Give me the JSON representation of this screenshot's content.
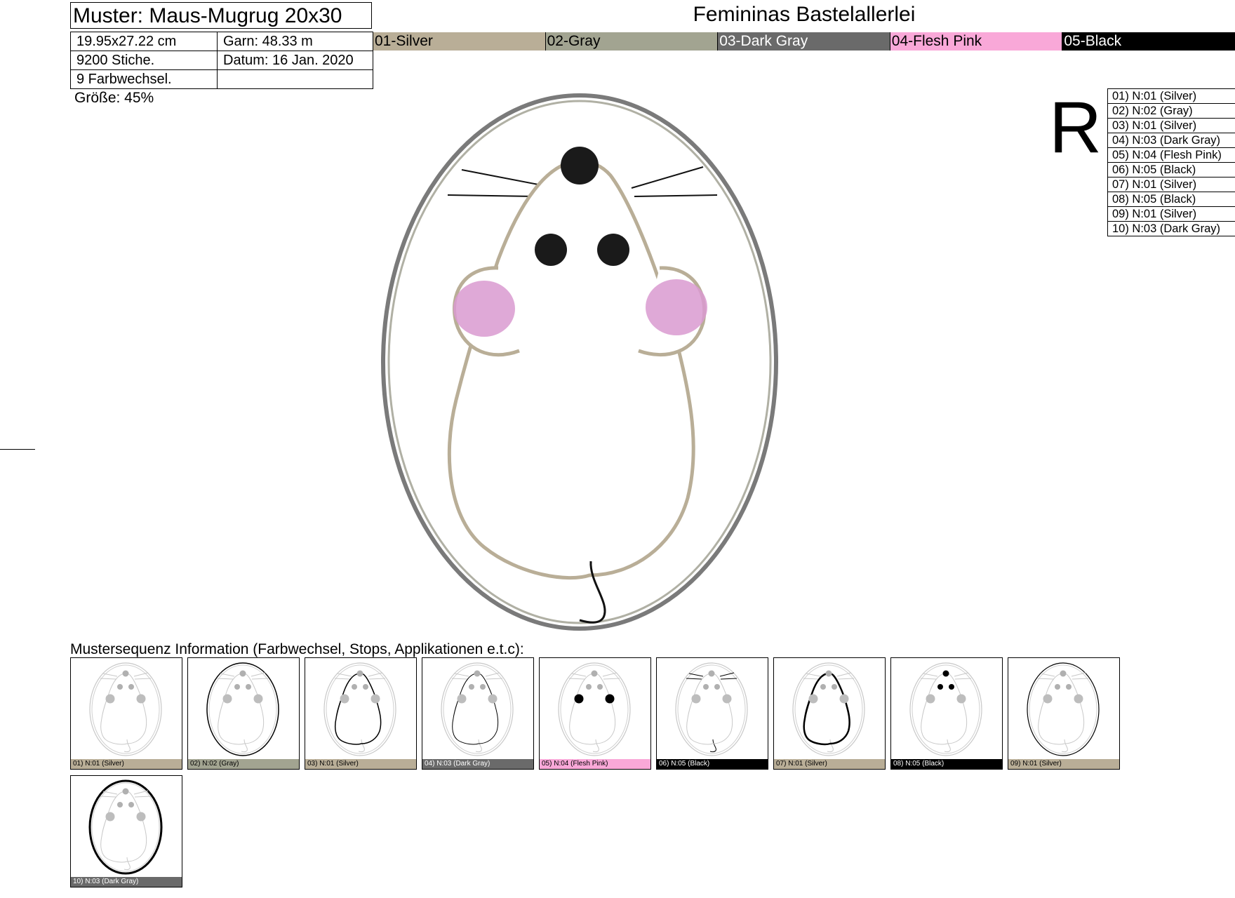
{
  "header": {
    "title": "Muster: Maus-Mugrug 20x30",
    "dimensions": "19.95x27.22 cm",
    "yarn": "Garn: 48.33 m",
    "stitches": "9200 Stiche.",
    "date": "Datum: 16 Jan. 2020",
    "color_changes": "9 Farbwechsel.",
    "size": "Größe: 45%"
  },
  "company": "Femininas Bastelallerlei",
  "rotation_marker": "R",
  "palette": [
    {
      "label": "01-Silver",
      "color": "#b9ae97",
      "text": "#000000"
    },
    {
      "label": "02-Gray",
      "color": "#a2a491",
      "text": "#000000"
    },
    {
      "label": "03-Dark Gray",
      "color": "#6a6a6a",
      "text": "#ffffff"
    },
    {
      "label": "04-Flesh Pink",
      "color": "#f9a8d8",
      "text": "#000000"
    },
    {
      "label": "05-Black",
      "color": "#000000",
      "text": "#ffffff"
    }
  ],
  "sequence": [
    "01) N:01 (Silver)",
    "02) N:02 (Gray)",
    "03) N:01 (Silver)",
    "04) N:03 (Dark Gray)",
    "05) N:04 (Flesh Pink)",
    "06) N:05 (Black)",
    "07) N:01 (Silver)",
    "08) N:05 (Black)",
    "09) N:01 (Silver)",
    "10) N:03 (Dark Gray)"
  ],
  "thumbnails": {
    "label": "Mustersequenz Information (Farbwechsel, Stops, Applikationen e.t.c):",
    "items": [
      {
        "caption": "01) N:01 (Silver)",
        "color": "#b9ae97",
        "text": "#000000",
        "highlight": "none"
      },
      {
        "caption": "02) N:02 (Gray)",
        "color": "#a2a491",
        "text": "#000000",
        "highlight": "oval-inner"
      },
      {
        "caption": "03) N:01 (Silver)",
        "color": "#b9ae97",
        "text": "#000000",
        "highlight": "body"
      },
      {
        "caption": "04) N:03 (Dark Gray)",
        "color": "#6a6a6a",
        "text": "#ffffff",
        "highlight": "body-thin"
      },
      {
        "caption": "05) N:04 (Flesh Pink)",
        "color": "#f9a8d8",
        "text": "#000000",
        "highlight": "cheeks"
      },
      {
        "caption": "06) N:05 (Black)",
        "color": "#000000",
        "text": "#ffffff",
        "highlight": "whiskers-tail"
      },
      {
        "caption": "07) N:01 (Silver)",
        "color": "#b9ae97",
        "text": "#000000",
        "highlight": "body-bold"
      },
      {
        "caption": "08) N:05 (Black)",
        "color": "#000000",
        "text": "#ffffff",
        "highlight": "eyes-nose"
      },
      {
        "caption": "09) N:01 (Silver)",
        "color": "#b9ae97",
        "text": "#000000",
        "highlight": "oval-thin"
      },
      {
        "caption": "10) N:03 (Dark Gray)",
        "color": "#6a6a6a",
        "text": "#ffffff",
        "highlight": "oval-outer"
      }
    ]
  }
}
